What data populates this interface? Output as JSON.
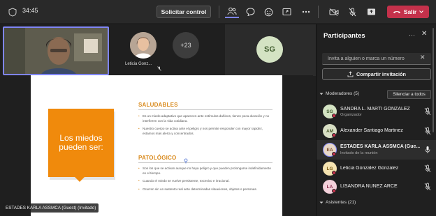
{
  "topbar": {
    "timer": "34:45",
    "control_label": "Solicitar control",
    "leave_label": "Salir",
    "accent": "#7f85f5",
    "leave_color": "#c4314b"
  },
  "stage": {
    "thumbs": [
      {
        "name": "Leticia Gonz..."
      },
      {
        "count": "+23"
      },
      {
        "initials": "SG"
      }
    ],
    "presenter_badge": "ESTADES KARLA ASSMCA (Guest) (Invitado)",
    "slide": {
      "headline": "Los miedos pueden ser:",
      "sections": [
        {
          "title": "SALUDABLES",
          "bullets": [
            "Es un miedo adaptativo que aparecen ante estímulos dañinos, tienen poca duración y no interfieren con la vida cotidiana.",
            "Nuestro cuerpo se activa ante el peligro y nos permite responder con mayor rapidez, estamos más alerta y concentrados."
          ]
        },
        {
          "title": "PATOLÓGICO",
          "bullets": [
            "Son los que se activan aunque no haya peligro y que pueden prolongarse indefinidamente en el tiempo.",
            "Cuando el miedo se vuelve persistente, excesivo e irracional.",
            "Ocurren sin un sustento real ante determinadas situaciones, objetos o personas."
          ]
        }
      ],
      "accent": "#f08a0c"
    }
  },
  "panel": {
    "title": "Participantes",
    "invite_placeholder": "Invita a alguien o marca un número",
    "share_label": "Compartir invitación",
    "moderators_header": "Moderadores (5)",
    "mute_all_label": "Silenciar a todos",
    "attendees_header": "Asistentes (21)",
    "participants": [
      {
        "initials": "SG",
        "name": "SANDRA L. MARTI GONZALEZ",
        "role": "Organizador",
        "avatar_bg": "#d4e3c3",
        "avatar_fg": "#3e5a2c",
        "mic": "muted"
      },
      {
        "initials": "AM",
        "name": "Alexander Santiago Martinez",
        "role": "",
        "avatar_bg": "#d8dfc4",
        "avatar_fg": "#4a5a2a",
        "mic": "muted"
      },
      {
        "initials": "EA",
        "name": "ESTADES KARLA ASSMCA (Gue...",
        "role": "Invitado de la reunión",
        "avatar_bg": "#e8d8c8",
        "avatar_fg": "#7a4a2a",
        "mic": "on"
      },
      {
        "initials": "LG",
        "name": "Leticia Gonzalez Gonzalez",
        "role": "",
        "avatar_bg": "#f5e3b0",
        "avatar_fg": "#7a5a10",
        "mic": "muted"
      },
      {
        "initials": "LA",
        "name": "LISANDRA NUNEZ ARCE",
        "role": "",
        "avatar_bg": "#f3d0da",
        "avatar_fg": "#8a2a4a",
        "mic": "muted"
      }
    ]
  }
}
